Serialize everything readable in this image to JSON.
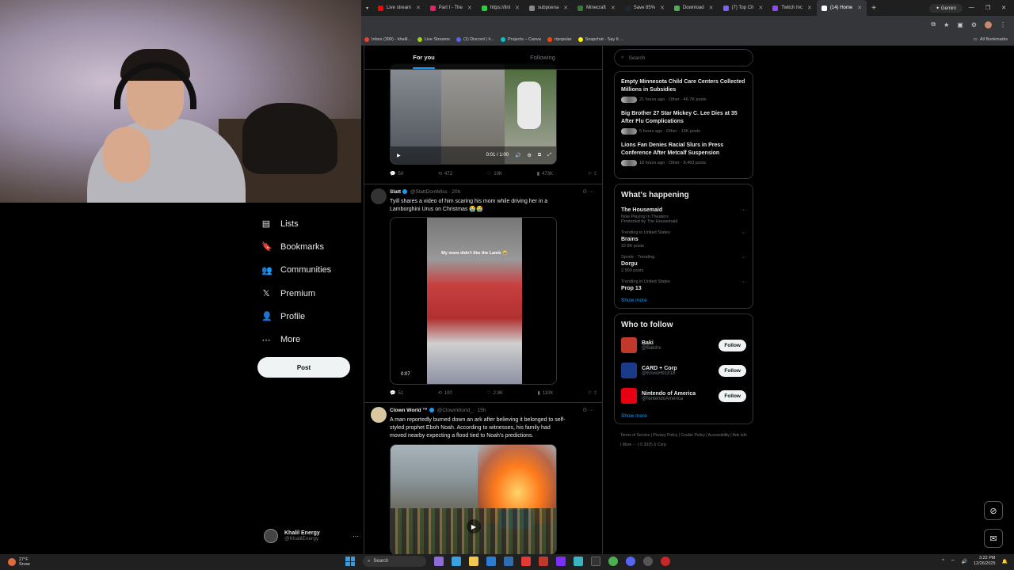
{
  "browser": {
    "tabs": [
      {
        "label": "Live stream",
        "color": "#ff0000"
      },
      {
        "label": "Part I - The",
        "color": "#e91e63"
      },
      {
        "label": "https://linl",
        "color": "#2ecc40"
      },
      {
        "label": "subpoena",
        "color": "#888888"
      },
      {
        "label": "Minecraft",
        "color": "#2e7d32"
      },
      {
        "label": "Save 85%",
        "color": "#1b2838"
      },
      {
        "label": "Download",
        "color": "#4caf50"
      },
      {
        "label": "(7) Top Ch",
        "color": "#7b61ff"
      },
      {
        "label": "Twitch Inc",
        "color": "#9146ff"
      },
      {
        "label": "(14) Home",
        "color": "#ffffff",
        "active": true
      }
    ],
    "gemini_label": "Gemini",
    "bookmarks": [
      {
        "label": "Inbox (399) - khalil...",
        "color": "#ea4335"
      },
      {
        "label": "Live Streams",
        "color": "#9cd21e"
      },
      {
        "label": "(1) Discord | #...",
        "color": "#5865f2"
      },
      {
        "label": "Projects – Canva",
        "color": "#00c4cc"
      },
      {
        "label": "r/popular",
        "color": "#ff4500"
      },
      {
        "label": "Snapchat - Say It ...",
        "color": "#fffc00"
      }
    ],
    "all_bookmarks": "All Bookmarks"
  },
  "nav": {
    "items": [
      {
        "label": "Lists",
        "icon": "list-icon",
        "glyph": "▤"
      },
      {
        "label": "Bookmarks",
        "icon": "bookmark-icon",
        "glyph": "🔖"
      },
      {
        "label": "Communities",
        "icon": "communities-icon",
        "glyph": "👥"
      },
      {
        "label": "Premium",
        "icon": "x-logo-icon",
        "glyph": "𝕏"
      },
      {
        "label": "Profile",
        "icon": "profile-icon",
        "glyph": "👤"
      },
      {
        "label": "More",
        "icon": "more-circle-icon",
        "glyph": "⋯"
      }
    ],
    "post_label": "Post",
    "account": {
      "name": "Khalil Energy",
      "handle": "@KhalilEnergy"
    }
  },
  "feed": {
    "tabs": [
      "For you",
      "Following"
    ],
    "top_video": {
      "time": "0:01 / 1:00",
      "replies": "50",
      "reposts": "472",
      "likes": "10K",
      "views": "473K"
    },
    "tweets": [
      {
        "name": "Slatt",
        "handle": "@SlattDontMiss",
        "time": "20h",
        "text": "Tyill shares a video of him scaring his mom while driving her in a Lamborghini Urus on Christmas 😭😭",
        "video_caption": "My mom didn't like the Lamb 😅",
        "duration": "0:07",
        "replies": "51",
        "reposts": "100",
        "likes": "2.9K",
        "views": "110K"
      },
      {
        "name": "Clown World ™",
        "handle": "@ClownWorld_",
        "time": "15h",
        "text": "A man reportedly burned down an ark after believing it belonged to self-styled prophet Eboh Noah. According to witnesses, his family had moved nearby expecting a flood tied to Noah's predictions."
      }
    ]
  },
  "right": {
    "search_placeholder": "Search",
    "news": [
      {
        "title": "Empty Minnesota Child Care Centers Collected Millions in Subsidies",
        "meta": "21 hours ago · Other · 46.7K posts"
      },
      {
        "title": "Big Brother 27 Star Mickey C. Lee Dies at 35 After Flu Complications",
        "meta": "5 hours ago · Other · 13K posts"
      },
      {
        "title": "Lions Fan Denies Racial Slurs in Press Conference After Metcalf Suspension",
        "meta": "18 hours ago · Other · 8,463 posts"
      }
    ],
    "happening_title": "What's happening",
    "trends": [
      {
        "ctx": "",
        "name": "The Housemaid",
        "sub": "Now Playing In Theaters",
        "cnt": "Promoted by The Housemaid"
      },
      {
        "ctx": "Trending in United States",
        "name": "Brains",
        "sub": "",
        "cnt": "32.8K posts"
      },
      {
        "ctx": "Sports · Trending",
        "name": "Dorgu",
        "sub": "",
        "cnt": "2,990 posts"
      },
      {
        "ctx": "Trending in United States",
        "name": "Prop 13",
        "sub": "",
        "cnt": ""
      }
    ],
    "show_more": "Show more",
    "who_title": "Who to follow",
    "follow": [
      {
        "name": "Baki",
        "handle": "@BakiIrx",
        "color": "#c0392b"
      },
      {
        "name": "CARD + Corp",
        "handle": "@EnvioH91818",
        "color": "#1a3a8a"
      },
      {
        "name": "Nintendo of America",
        "handle": "@NintendoAmerica",
        "color": "#e60012"
      }
    ],
    "follow_label": "Follow",
    "footer": [
      "Terms of Service",
      "Privacy Policy",
      "Cookie Policy",
      "Accessibility",
      "Ads info",
      "More ···",
      "© 2025 X Corp."
    ]
  },
  "taskbar": {
    "weather_temp": "27°F",
    "weather_desc": "Snow",
    "search_label": "Search",
    "time": "3:22 PM",
    "date": "12/26/2025"
  }
}
